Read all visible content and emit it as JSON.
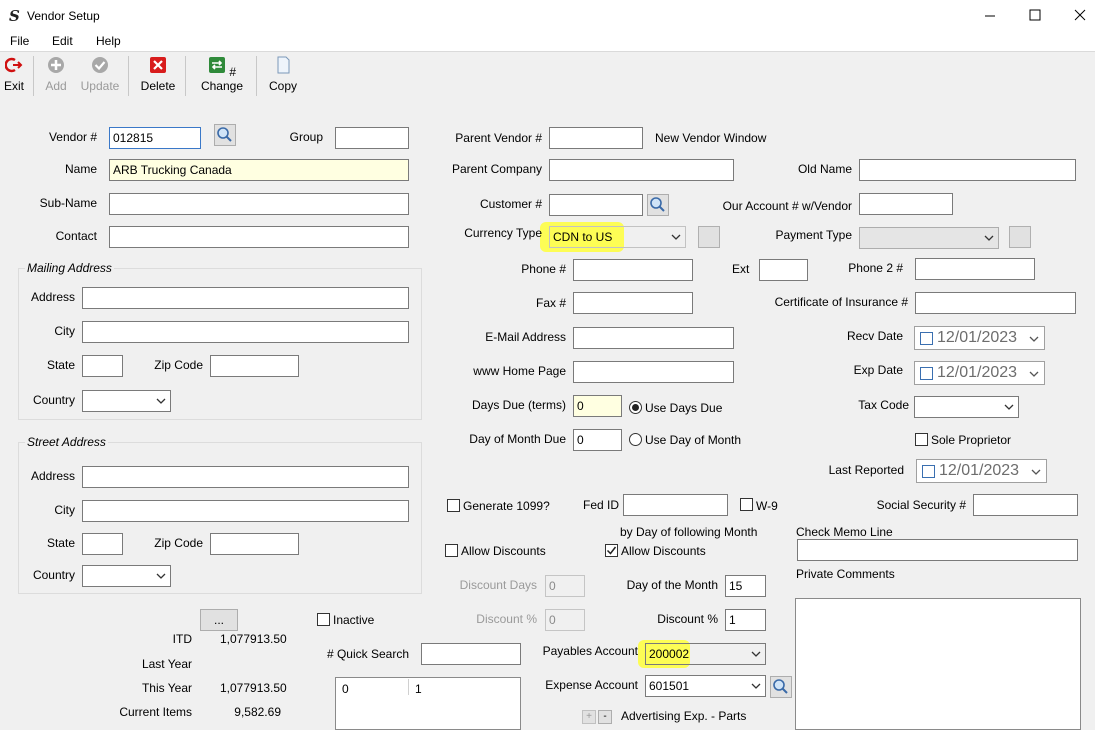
{
  "window": {
    "title": "Vendor Setup"
  },
  "menu": {
    "file": "File",
    "edit": "Edit",
    "help": "Help"
  },
  "toolbar": {
    "exit": "Exit",
    "add": "Add",
    "update": "Update",
    "delete": "Delete",
    "change": "# Change",
    "copy": "Copy"
  },
  "left": {
    "vendor_label": "Vendor #",
    "vendor_value": "012815",
    "group_label": "Group",
    "group_value": "",
    "name_label": "Name",
    "name_value": "ARB Trucking Canada",
    "subname_label": "Sub-Name",
    "contact_label": "Contact",
    "mailing": {
      "title": "Mailing Address",
      "address": "Address",
      "city": "City",
      "state": "State",
      "zip": "Zip Code",
      "country": "Country"
    },
    "street": {
      "title": "Street Address",
      "address": "Address",
      "city": "City",
      "state": "State",
      "zip": "Zip Code",
      "country": "Country"
    },
    "more_button": "...",
    "itd_label": "ITD",
    "itd_value": "1,077913.50",
    "last_year_label": "Last Year",
    "last_year_value": "",
    "this_year_label": "This Year",
    "this_year_value": "1,077913.50",
    "current_items_label": "Current Items",
    "current_items_value": "9,582.69"
  },
  "middle": {
    "parent_vendor_label": "Parent Vendor #",
    "new_vendor_window": "New Vendor Window",
    "parent_company_label": "Parent Company",
    "customer_label": "Customer #",
    "currency_type_label": "Currency Type",
    "currency_type_value": "CDN to US",
    "phone_label": "Phone #",
    "ext_label": "Ext",
    "fax_label": "Fax #",
    "email_label": "E-Mail Address",
    "www_label": "www Home Page",
    "days_due_label": "Days Due (terms)",
    "days_due_value": "0",
    "use_days_due": "Use Days Due",
    "day_of_month_due_label": "Day of Month Due",
    "day_of_month_due_value": "0",
    "use_day_of_month": "Use Day of Month",
    "generate_1099": "Generate 1099?",
    "fed_id_label": "Fed ID",
    "w9_label": "W-9",
    "by_day_following": "by Day of following Month",
    "allow_discounts_1": "Allow Discounts",
    "allow_discounts_2": "Allow Discounts",
    "discount_days_label": "Discount Days",
    "discount_days_value": "0",
    "discount_pct_label": "Discount %",
    "discount_pct_value": "0",
    "day_of_month_label": "Day of the Month",
    "day_of_month_value": "15",
    "discount_pct2_label": "Discount %",
    "discount_pct2_value": "1",
    "inactive_label": "Inactive",
    "quick_search_label": "# Quick Search",
    "quick_list": {
      "col1": "0",
      "col2": "1"
    },
    "payables_account_label": "Payables Account",
    "payables_account_value": "200002",
    "expense_account_label": "Expense Account",
    "expense_account_value": "601501",
    "expense_account_desc": "Advertising Exp. - Parts",
    "plus": "+",
    "minus": "-"
  },
  "right": {
    "old_name_label": "Old Name",
    "our_account_label": "Our Account # w/Vendor",
    "payment_type_label": "Payment Type",
    "phone2_label": "Phone 2 #",
    "cert_insurance_label": "Certificate of Insurance #",
    "recv_date_label": "Recv Date",
    "recv_date_value": "12/01/2023",
    "exp_date_label": "Exp Date",
    "exp_date_value": "12/01/2023",
    "tax_code_label": "Tax Code",
    "sole_proprietor": "Sole Proprietor",
    "last_reported_label": "Last Reported",
    "last_reported_value": "12/01/2023",
    "ssn_label": "Social Security #",
    "check_memo_label": "Check Memo Line",
    "private_comments_label": "Private Comments"
  }
}
